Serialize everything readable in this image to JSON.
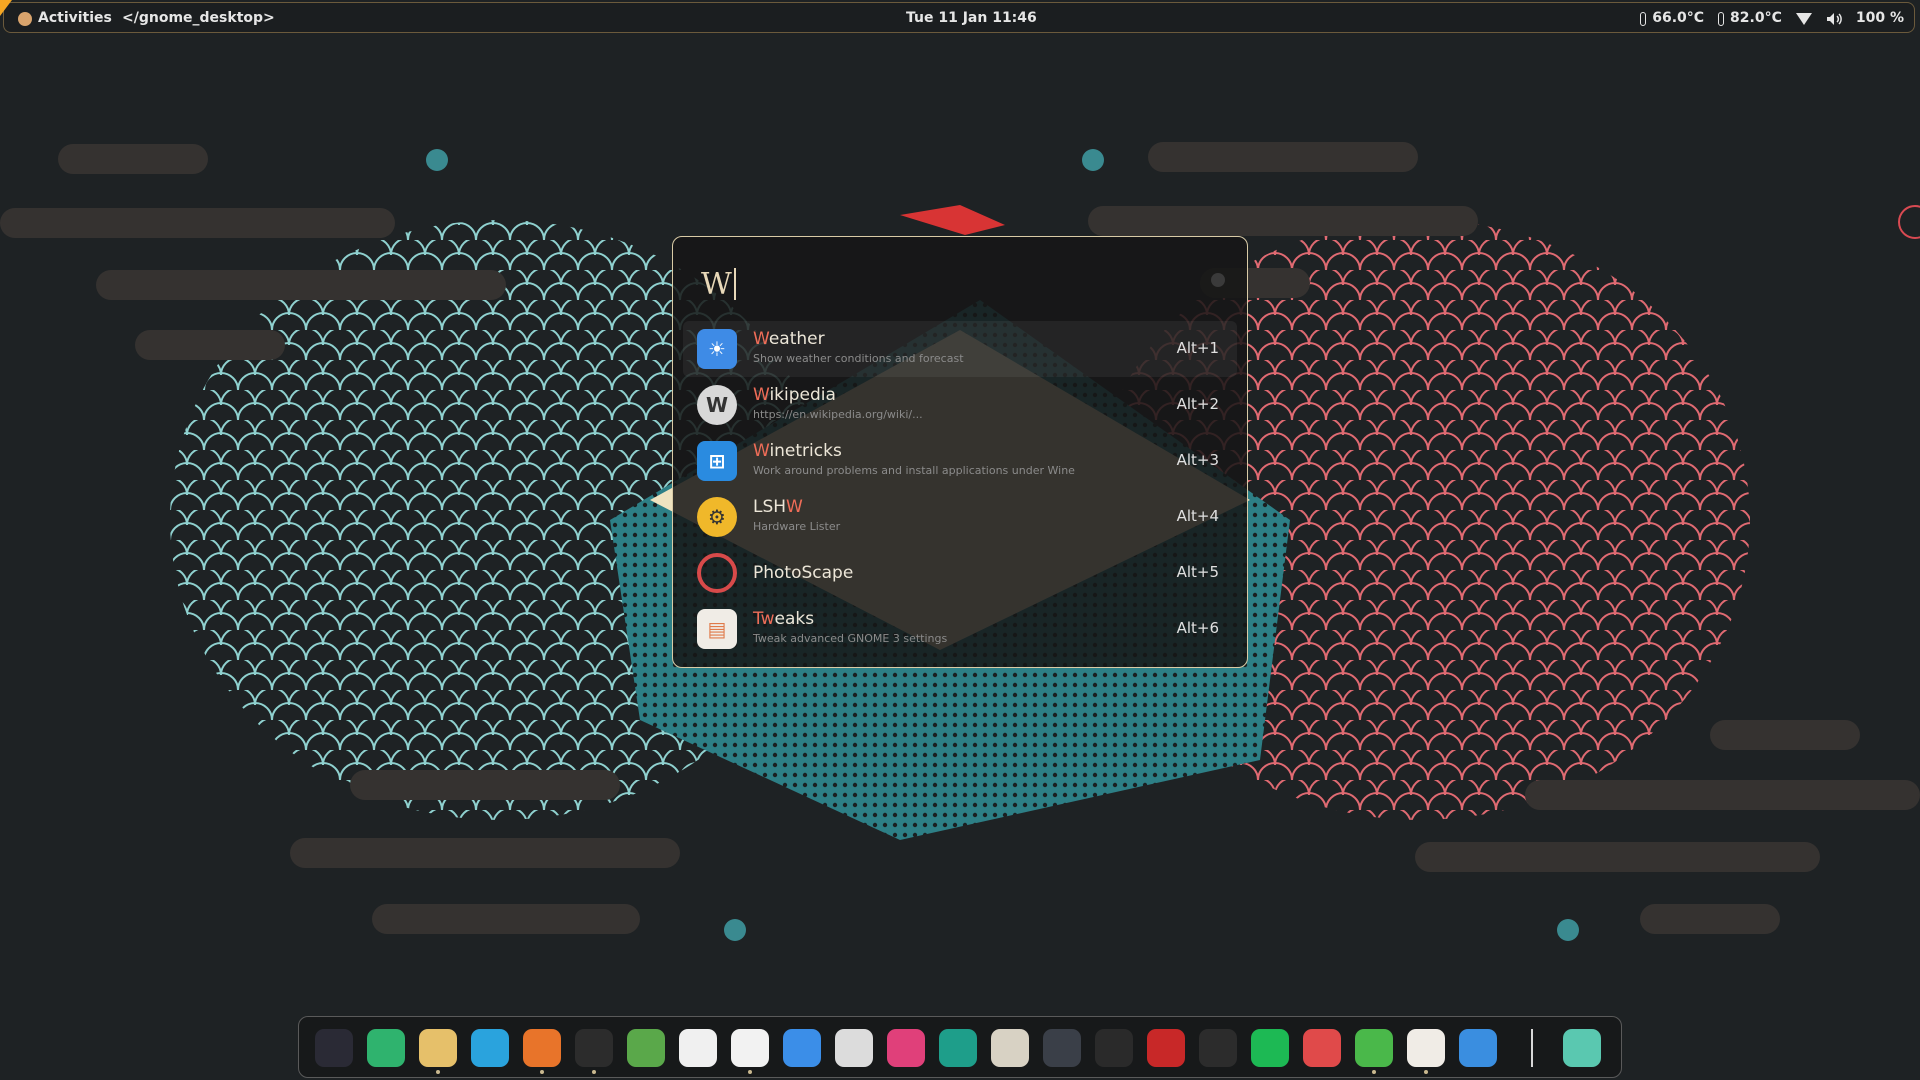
{
  "topbar": {
    "activities_label": "Activities",
    "workspace_title": "</gnome_desktop>",
    "clock": "Tue 11 Jan  11:46",
    "temp1": "66.0°C",
    "temp2": "82.0°C",
    "battery": "100 %"
  },
  "launcher": {
    "query": "W",
    "results": [
      {
        "name_highlight": "W",
        "name_rest": "eather",
        "desc": "Show weather conditions and forecast",
        "shortcut": "Alt+1",
        "icon": "weather-icon"
      },
      {
        "name_highlight": "W",
        "name_rest": "ikipedia",
        "desc": "https://en.wikipedia.org/wiki/...",
        "shortcut": "Alt+2",
        "icon": "wikipedia-icon"
      },
      {
        "name_highlight": "W",
        "name_rest": "inetricks",
        "desc": "Work around problems and install applications under Wine",
        "shortcut": "Alt+3",
        "icon": "winetricks-icon"
      },
      {
        "name_prefix": "LSH",
        "name_highlight": "W",
        "name_rest": "",
        "desc": "Hardware Lister",
        "shortcut": "Alt+4",
        "icon": "lshw-icon"
      },
      {
        "name": "PhotoScape",
        "desc": "",
        "shortcut": "Alt+5",
        "icon": "photoscape-icon"
      },
      {
        "name_highlight": "Tw",
        "name_rest": "eaks",
        "desc": "Tweak advanced GNOME 3 settings",
        "shortcut": "Alt+6",
        "icon": "tweaks-icon"
      }
    ]
  },
  "dock": {
    "items": [
      {
        "icon": "budgie-icon",
        "color": "#2a2a35"
      },
      {
        "icon": "download-manager-icon",
        "color": "#2fb36e"
      },
      {
        "icon": "files-icon",
        "color": "#e6c06a"
      },
      {
        "icon": "telegram-icon",
        "color": "#2aa3dd"
      },
      {
        "icon": "firefox-icon",
        "color": "#e8742a"
      },
      {
        "icon": "terminal-icon",
        "color": "#2c2c2c"
      },
      {
        "icon": "inkscape-icon",
        "color": "#5aa84a"
      },
      {
        "icon": "text-editor-icon",
        "color": "#f0f0f0"
      },
      {
        "icon": "color-picker-icon",
        "color": "#f2f2f2"
      },
      {
        "icon": "messages-icon",
        "color": "#3b8ee8"
      },
      {
        "icon": "dconf-editor-icon",
        "color": "#dcdcdc"
      },
      {
        "icon": "instagram-icon",
        "color": "#e0407a"
      },
      {
        "icon": "screenshot-icon",
        "color": "#1e9e8a"
      },
      {
        "icon": "gimp-icon",
        "color": "#d8d2c4"
      },
      {
        "icon": "github-desktop-icon",
        "color": "#3a3f48"
      },
      {
        "icon": "figma-icon",
        "color": "#2a2a2a"
      },
      {
        "icon": "kdenlive-icon",
        "color": "#c82828"
      },
      {
        "icon": "screen-capture-icon",
        "color": "#2c2c2c"
      },
      {
        "icon": "spotify-icon",
        "color": "#1db954"
      },
      {
        "icon": "audio-icon",
        "color": "#e04a4a"
      },
      {
        "icon": "extensions-icon",
        "color": "#4ab84a"
      },
      {
        "icon": "tweaks-dock-icon",
        "color": "#f0ece6"
      },
      {
        "icon": "settings-icon",
        "color": "#3a8ee0"
      },
      {
        "icon": "trash-icon",
        "color": "#5ac8b0"
      }
    ]
  }
}
